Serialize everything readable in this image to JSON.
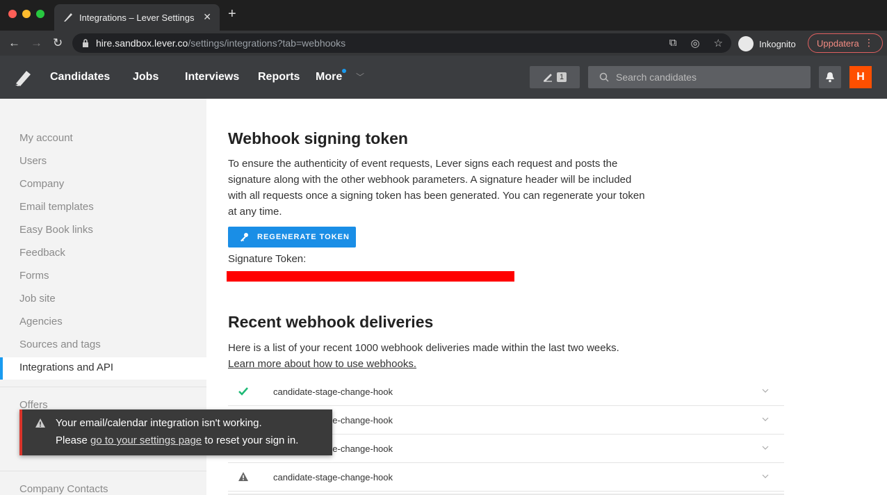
{
  "browser": {
    "tab_title": "Integrations – Lever Settings",
    "url_host": "hire.sandbox.lever.co",
    "url_path": "/settings/integrations?tab=webhooks",
    "profile_label": "Inkognito",
    "update_label": "Uppdatera"
  },
  "header": {
    "nav": [
      "Candidates",
      "Jobs",
      "Interviews",
      "Reports",
      "More"
    ],
    "pencil_count": "1",
    "search_placeholder": "Search candidates",
    "avatar_letter": "H"
  },
  "sidebar": {
    "items": [
      "My account",
      "Users",
      "Company",
      "Email templates",
      "Easy Book links",
      "Feedback",
      "Forms",
      "Job site",
      "Agencies",
      "Sources and tags",
      "Integrations and API"
    ],
    "lower_items": [
      "Offers",
      "Company Contacts"
    ]
  },
  "toast": {
    "line1": "Your email/calendar integration isn't working.",
    "line2_prefix": "Please ",
    "line2_link": "go to your settings page",
    "line2_suffix": " to reset your sign in."
  },
  "signing": {
    "title": "Webhook signing token",
    "description": "To ensure the authenticity of event requests, Lever signs each request and posts the signature along with the other webhook parameters. A signature header will be included with all requests once a signing token has been generated. You can regenerate your token at any time.",
    "regenerate_label": "REGENERATE TOKEN",
    "token_label": "Signature Token:"
  },
  "deliveries": {
    "title": "Recent webhook deliveries",
    "description": "Here is a list of your recent 1000 webhook deliveries made within the last two weeks.",
    "learn_more": "Learn more about how to use webhooks.",
    "rows": [
      {
        "status": "success",
        "name": "candidate-stage-change-hook"
      },
      {
        "status": "success",
        "name": "candidate-stage-change-hook"
      },
      {
        "status": "success",
        "name": "candidate-stage-change-hook"
      },
      {
        "status": "warning",
        "name": "candidate-stage-change-hook"
      }
    ]
  },
  "colors": {
    "accent": "#1a8ee6",
    "success": "#1db975",
    "error": "#d9342b",
    "avatar": "#ff4f00"
  }
}
